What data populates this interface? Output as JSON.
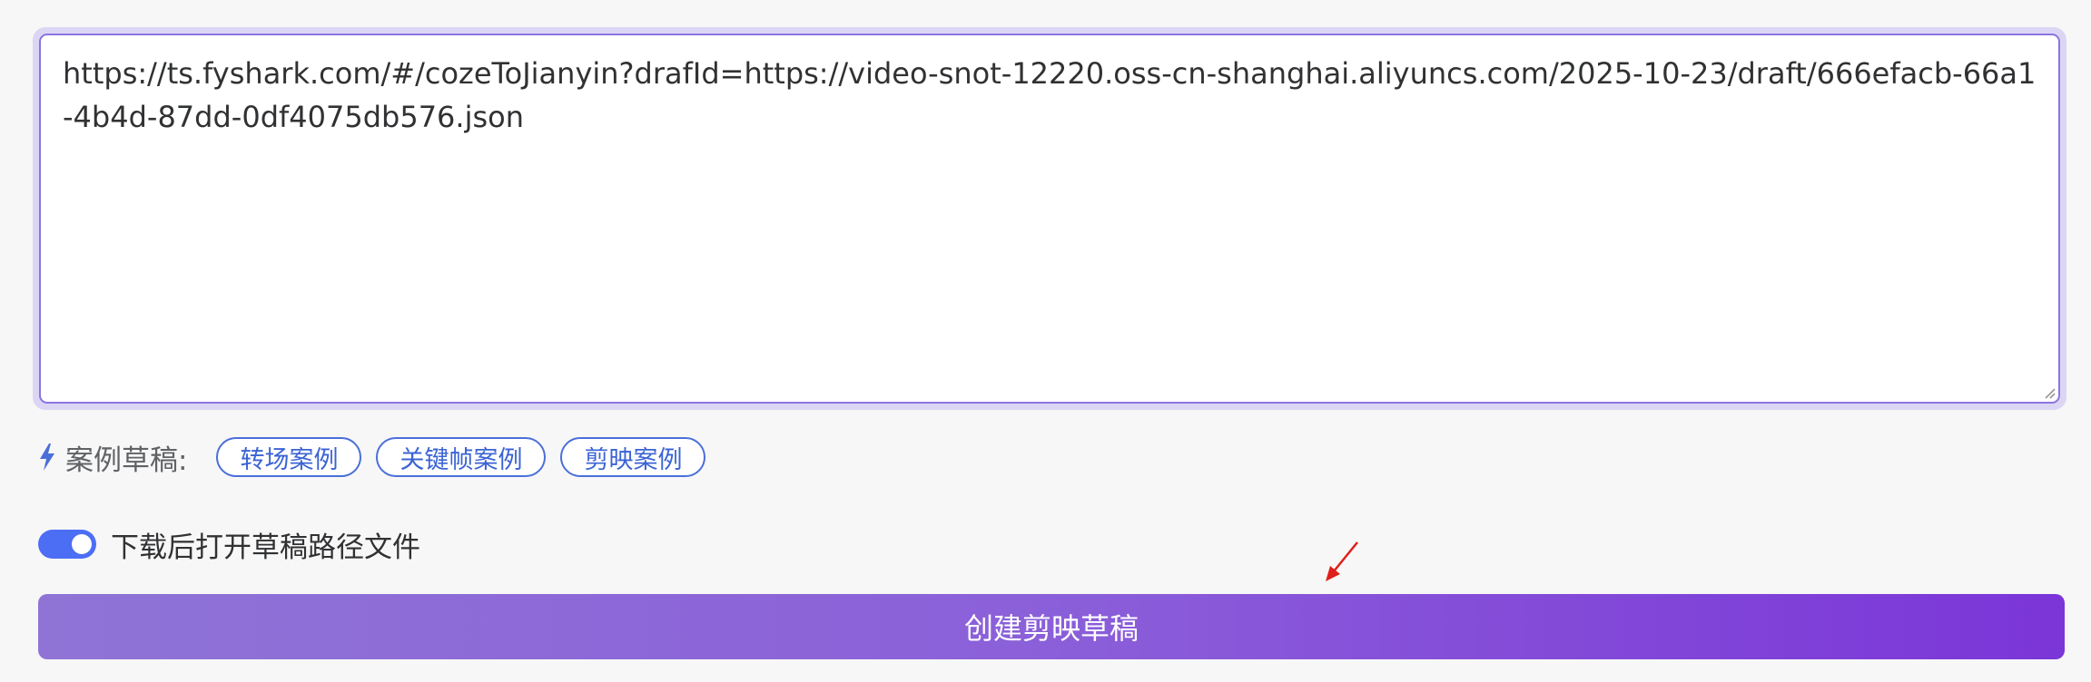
{
  "editor": {
    "value": "https://ts.fyshark.com/#/cozeToJianyin?drafId=https://video-snot-12220.oss-cn-shanghai.aliyuncs.com/2025-10-23/draft/666efacb-66a1-4b4d-87dd-0df4075db576.json"
  },
  "examples": {
    "icon": "bolt-icon",
    "label": "案例草稿:",
    "chips": [
      {
        "label": "转场案例"
      },
      {
        "label": "关键帧案例"
      },
      {
        "label": "剪映案例"
      }
    ]
  },
  "toggle": {
    "label": "下载后打开草稿路径文件",
    "on": true,
    "color": "#4c6ef5"
  },
  "create_button": {
    "label": "创建剪映草稿"
  },
  "colors": {
    "accent": "#8d74e0",
    "chip": "#3b63d4",
    "button_start": "#8f74d6",
    "button_end": "#7b35d8",
    "annotation_arrow": "#e0201a"
  }
}
